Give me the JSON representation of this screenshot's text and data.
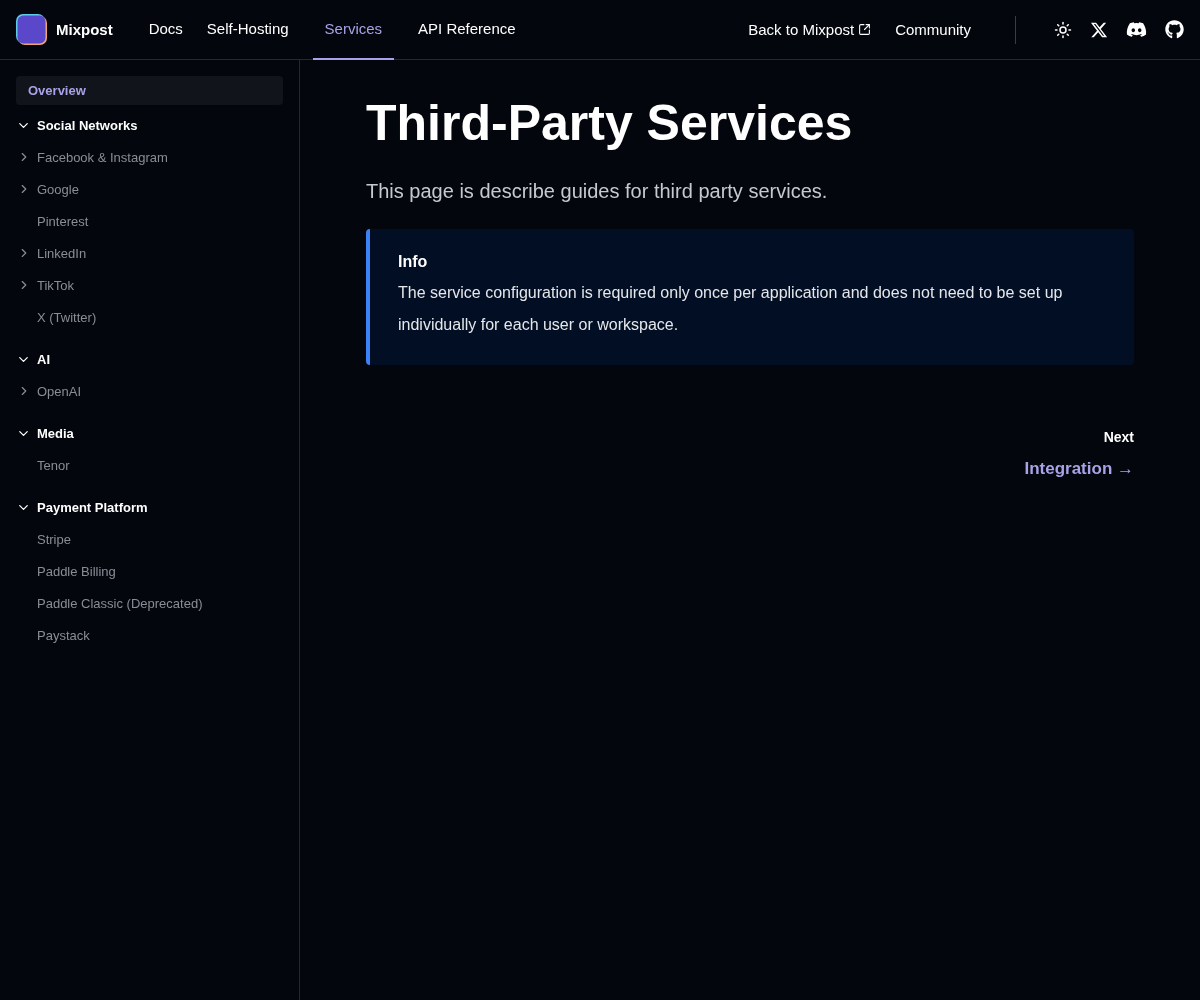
{
  "header": {
    "brand": "Mixpost",
    "nav": [
      {
        "label": "Docs",
        "selected": false
      },
      {
        "label": "Self-Hosting",
        "selected": false
      },
      {
        "label": "Services",
        "selected": true
      },
      {
        "label": "API Reference",
        "selected": false
      }
    ],
    "links": [
      {
        "label": "Back to Mixpost",
        "kind": "external"
      },
      {
        "label": "Community",
        "kind": "plain"
      }
    ]
  },
  "sidebar": {
    "items": [
      {
        "kind": "page",
        "label": "Overview",
        "selected": true
      },
      {
        "kind": "group",
        "label": "Social Networks",
        "expanded": true,
        "children": [
          {
            "label": "Facebook & Instagram",
            "kind": "folder",
            "selected": false
          },
          {
            "label": "Google",
            "kind": "folder",
            "selected": false
          },
          {
            "label": "Pinterest",
            "kind": "page",
            "selected": false
          },
          {
            "label": "LinkedIn",
            "kind": "folder",
            "selected": false
          },
          {
            "label": "TikTok",
            "kind": "folder",
            "selected": false
          },
          {
            "label": "X (Twitter)",
            "kind": "page",
            "selected": false
          }
        ]
      },
      {
        "kind": "group",
        "label": "AI",
        "expanded": true,
        "children": [
          {
            "label": "OpenAI",
            "kind": "folder",
            "selected": false
          }
        ]
      },
      {
        "kind": "group",
        "label": "Media",
        "expanded": true,
        "children": [
          {
            "label": "Tenor",
            "kind": "page",
            "selected": false
          }
        ]
      },
      {
        "kind": "group",
        "label": "Payment Platform",
        "expanded": true,
        "children": [
          {
            "label": "Stripe",
            "kind": "page",
            "selected": false
          },
          {
            "label": "Paddle Billing",
            "kind": "page",
            "selected": false
          },
          {
            "label": "Paddle Classic (Deprecated)",
            "kind": "page",
            "selected": false
          },
          {
            "label": "Paystack",
            "kind": "page",
            "selected": false
          }
        ]
      }
    ]
  },
  "content": {
    "title": "Third-Party Services",
    "lead": "This page is describe guides for third party services.",
    "callout": {
      "title": "Info",
      "text": "The service configuration is required only once per application and does not need to be set up individually for each user or workspace."
    },
    "pager": {
      "label": "Next",
      "link": "Integration →"
    }
  }
}
